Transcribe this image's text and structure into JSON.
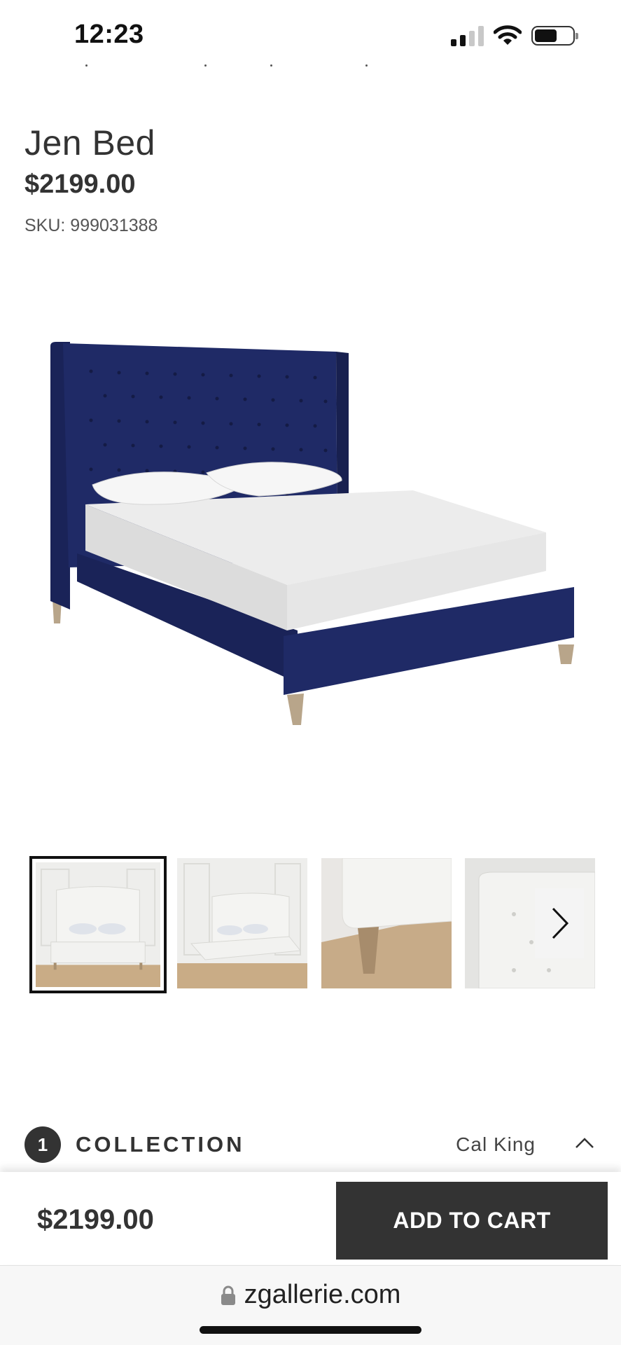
{
  "status_bar": {
    "time": "12:23",
    "battery_level": 0.6,
    "signal_bars_active": 2,
    "signal_bars_total": 4
  },
  "product": {
    "title": "Jen Bed",
    "price": "$2199.00",
    "sku": "SKU: 999031388"
  },
  "images": {
    "main_alt": "Jen Bed in navy velvet",
    "thumbnails_count": 4,
    "selected_index": 0,
    "next_icon": "chevron-right-icon"
  },
  "collection": {
    "step": "1",
    "label": "COLLECTION",
    "value": "Cal King",
    "icon": "chevron-up-icon"
  },
  "cart_bar": {
    "price": "$2199.00",
    "button_label": "ADD TO CART"
  },
  "browser": {
    "url": "zgallerie.com",
    "lock_icon": "lock-icon"
  },
  "colors": {
    "headboard_navy": "#1f2a66",
    "button_bg": "#333333",
    "text": "#333333"
  }
}
